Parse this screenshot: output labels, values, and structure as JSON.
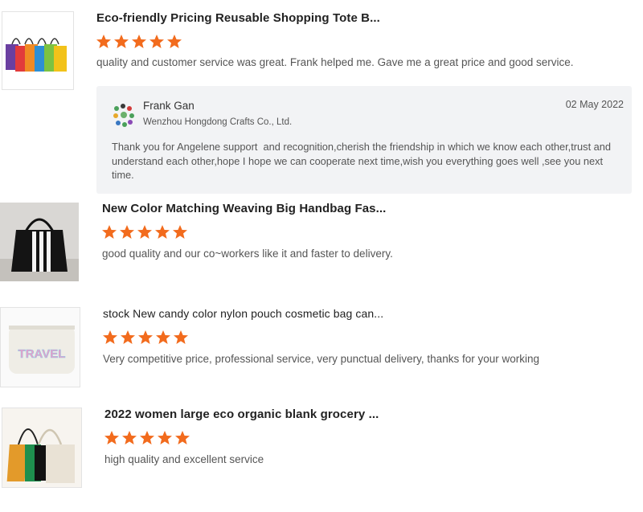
{
  "reviews": [
    {
      "title": "Eco-friendly Pricing Reusable Shopping Tote B...",
      "rating": 5,
      "comment": "quality and customer service was great. Frank helped me. Gave me a great price and good service.",
      "reply": {
        "name": "Frank Gan",
        "company": "Wenzhou Hongdong Crafts Co., Ltd.",
        "date": "02 May 2022",
        "text": "Thank you for Angelene support  and recognition,cherish the friendship in which we know each other,trust and understand each other,hope I hope we can cooperate next time,wish you everything goes well ,see you next time."
      }
    },
    {
      "title": "New Color Matching Weaving Big Handbag Fas...",
      "rating": 5,
      "comment": "good quality and our co~workers like it and faster to delivery."
    },
    {
      "title": "stock New candy color nylon pouch cosmetic bag can...",
      "rating": 5,
      "comment": "Very competitive price, professional service, very punctual delivery, thanks for your  working",
      "thumb_text": "TRAVEL"
    },
    {
      "title": "2022 women large eco organic blank grocery ...",
      "rating": 5,
      "comment": "high quality and excellent service"
    }
  ],
  "colors": {
    "star": "#f26b1d"
  }
}
